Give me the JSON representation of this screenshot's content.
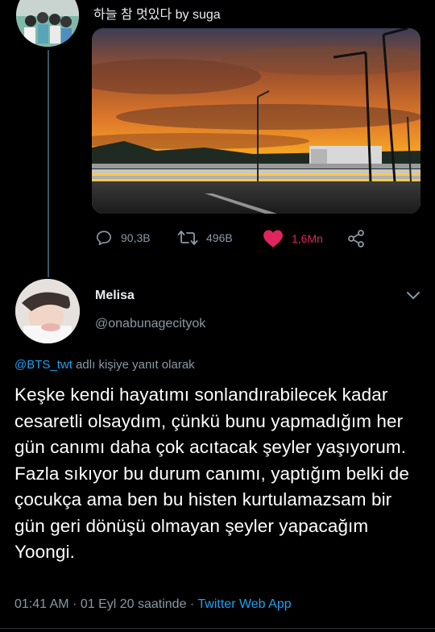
{
  "parent_tweet": {
    "text": "하늘 참 멋있다 by suga",
    "stats": {
      "replies": "90,3B",
      "retweets": "496B",
      "likes": "1,6Mn"
    }
  },
  "reply_tweet": {
    "display_name": "Melisa",
    "handle": "@onabunagecityok",
    "reply_to_mention": "@BTS_twt",
    "reply_to_suffix": " adlı kişiye yanıt olarak",
    "text": "Keşke kendi hayatımı sonlandırabilecek kadar cesaretli olsaydım, çünkü bunu yapmadığım her gün canımı daha çok acıtacak şeyler yaşıyorum. Fazla sıkıyor bu durum canımı, yaptığım belki de çocukça ama ben bu histen kurtulamazsam bir gün geri dönüşü olmayan şeyler yapacağım Yoongi.",
    "timestamp": "01:41 AM · 01 Eyl 20 saatinde · ",
    "source_app": "Twitter Web App"
  },
  "colors": {
    "background": "#000000",
    "accent": "#1da1f2",
    "like": "#e0245e",
    "muted": "#8899a6"
  },
  "icons": [
    "reply-icon",
    "retweet-icon",
    "heart-icon",
    "share-icon",
    "chevron-down-icon"
  ]
}
